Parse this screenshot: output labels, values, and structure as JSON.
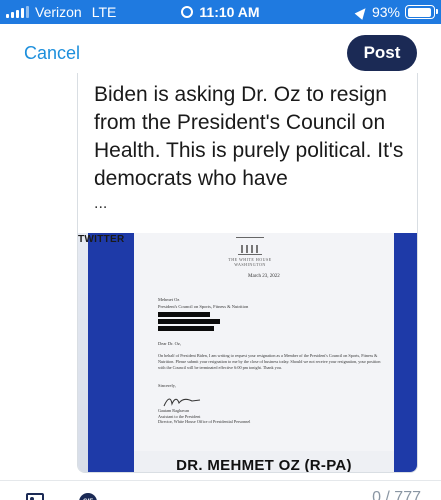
{
  "status_bar": {
    "carrier": "Verizon",
    "network": "LTE",
    "time": "11:10 AM",
    "battery": "93%",
    "battery_level": 0.93,
    "color": "#1f7ae0",
    "icons": [
      "signal-icon",
      "alarm-icon",
      "location-icon",
      "battery-icon"
    ]
  },
  "header": {
    "cancel_label": "Cancel",
    "post_label": "Post",
    "accent": "#1d8fdc",
    "post_button_color": "#1b2a55"
  },
  "quoted_post": {
    "text": "Biden is asking Dr. Oz to resign from the President's Council on Health. This is purely political. It's democrats who have",
    "ellipsis": "..."
  },
  "embedded_image": {
    "watermark": "TWITTER",
    "letterhead": "THE WHITE HOUSE",
    "location_line": "WASHINGTON",
    "date": "March 23, 2022",
    "address_name": "Mehmet Oz",
    "address_org": "President's Council on Sports, Fitness & Nutrition",
    "salutation": "Dear Dr. Oz,",
    "body": "On behalf of President Biden, I am writing to request your resignation as a Member of the President's Council on Sports, Fitness & Nutrition. Please submit your resignation to me by the close of business today. Should we not receive your resignation, your position with the Council will be terminated effective 6:00 pm tonight. Thank you.",
    "closing": "Sincerely,",
    "signer_name": "Gautam Raghavan",
    "signer_title_1": "Assistant to the President",
    "signer_title_2": "Director, White House Office of Presidential Personnel",
    "caption": "DR. MEHMET OZ (R-PA)"
  },
  "toolbar": {
    "char_count": "0 / 777",
    "icons": [
      "image-icon",
      "gif-icon"
    ]
  }
}
